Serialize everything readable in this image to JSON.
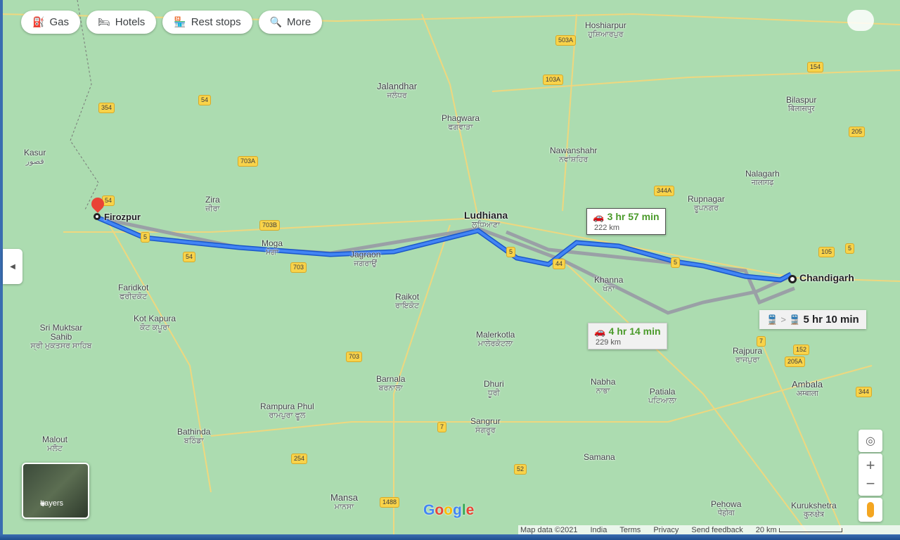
{
  "chips": [
    {
      "icon": "gas-icon",
      "glyph": "⛽",
      "label": "Gas"
    },
    {
      "icon": "bed-icon",
      "glyph": "🛏",
      "label": "Hotels"
    },
    {
      "icon": "rest-stop-icon",
      "glyph": "🏪",
      "label": "Rest stops"
    },
    {
      "icon": "search-icon",
      "glyph": "🔍",
      "label": "More"
    }
  ],
  "origin": "Firozpur",
  "destination": "Chandigarh",
  "routes": [
    {
      "mode": "car",
      "time": "3 hr 57 min",
      "distance": "222 km",
      "selected": true
    },
    {
      "mode": "car",
      "time": "4 hr 14 min",
      "distance": "229 km",
      "selected": false
    }
  ],
  "transit": {
    "time": "5 hr 10 min",
    "separator": ">"
  },
  "cities": [
    {
      "name": "Ludhiana",
      "native": "ਲੁਧਿਆਣਾ",
      "big": true
    },
    {
      "name": "Hoshiarpur",
      "native": "ਹੁਸ਼ਿਆਰਪੁਰ"
    },
    {
      "name": "Jalandhar",
      "native": "ਜਲੰਧਰ"
    },
    {
      "name": "Phagwara",
      "native": "ਫਗਵਾੜਾ"
    },
    {
      "name": "Moga",
      "native": "ਮੋਗਾ"
    },
    {
      "name": "Zira",
      "native": "ਜ਼ੀਰਾ"
    },
    {
      "name": "Faridkot",
      "native": "ਫਰੀਦਕੋਟ"
    },
    {
      "name": "Kot Kapura",
      "native": "ਕੋਟ ਕਪੂਰਾ"
    },
    {
      "name": "Sri Muktsar Sahib",
      "native": "ਸ੍ਰੀ ਮੁਕਤਸਰ ਸਾਹਿਬ"
    },
    {
      "name": "Bathinda",
      "native": "ਬਠਿੰਡਾ"
    },
    {
      "name": "Barnala",
      "native": "ਬਰਨਾਲਾ"
    },
    {
      "name": "Sangrur",
      "native": "ਸੰਗਰੂਰ"
    },
    {
      "name": "Malerkotla",
      "native": "ਮਾਲੇਰਕੋਟਲਾ"
    },
    {
      "name": "Khanna",
      "native": "ਖੰਨਾ"
    },
    {
      "name": "Patiala",
      "native": "ਪਟਿਆਲਾ"
    },
    {
      "name": "Nabha",
      "native": "ਨਾਭਾ"
    },
    {
      "name": "Rajpura",
      "native": "ਰਾਜਪੁਰਾ"
    },
    {
      "name": "Ambala",
      "native": "अम्बाला"
    },
    {
      "name": "Rupnagar",
      "native": "ਰੂਪਨਗਰ"
    },
    {
      "name": "Nawanshahr",
      "native": "ਨਵਾਂਸ਼ਹਿਰ"
    },
    {
      "name": "Kasur",
      "native": "قصور"
    },
    {
      "name": "Mansa",
      "native": "ਮਾਨਸਾ"
    },
    {
      "name": "Samana",
      "native": ""
    },
    {
      "name": "Kurukshetra",
      "native": "कुरुक्षेत्र"
    },
    {
      "name": "Pehowa",
      "native": "पेहोवा"
    },
    {
      "name": "Nalagarh",
      "native": "नालागढ़"
    },
    {
      "name": "Bilaspur",
      "native": "बिलासपुर"
    },
    {
      "name": "Raikot",
      "native": "ਰਾਇਕੋਟ"
    },
    {
      "name": "Dhuri",
      "native": "ਧੂਰੀ"
    },
    {
      "name": "Rampura Phul",
      "native": "ਰਾਮਪੁਰਾ ਫੂਲ"
    },
    {
      "name": "Malout",
      "native": "ਮਲੋਟ"
    },
    {
      "name": "Jagraon",
      "native": "ਜਗਰਾਉਂ"
    }
  ],
  "shields": [
    "5",
    "54",
    "54",
    "703",
    "703A",
    "703B",
    "44",
    "5",
    "5",
    "105",
    "5",
    "344A",
    "103A",
    "503A",
    "152",
    "7",
    "7",
    "254",
    "52",
    "1488",
    "703",
    "344",
    "205A",
    "154",
    "205",
    "354",
    "54"
  ],
  "layers_label": "Layers",
  "google_logo": "Google",
  "footer": {
    "map_data": "Map data ©2021",
    "region": "India",
    "terms": "Terms",
    "privacy": "Privacy",
    "feedback": "Send feedback",
    "scale": "20 km"
  },
  "colors": {
    "route": "#4285f4",
    "alt_route": "#9aa0a6",
    "map": "#acdcb0",
    "route_time": "#4a9a2a"
  }
}
